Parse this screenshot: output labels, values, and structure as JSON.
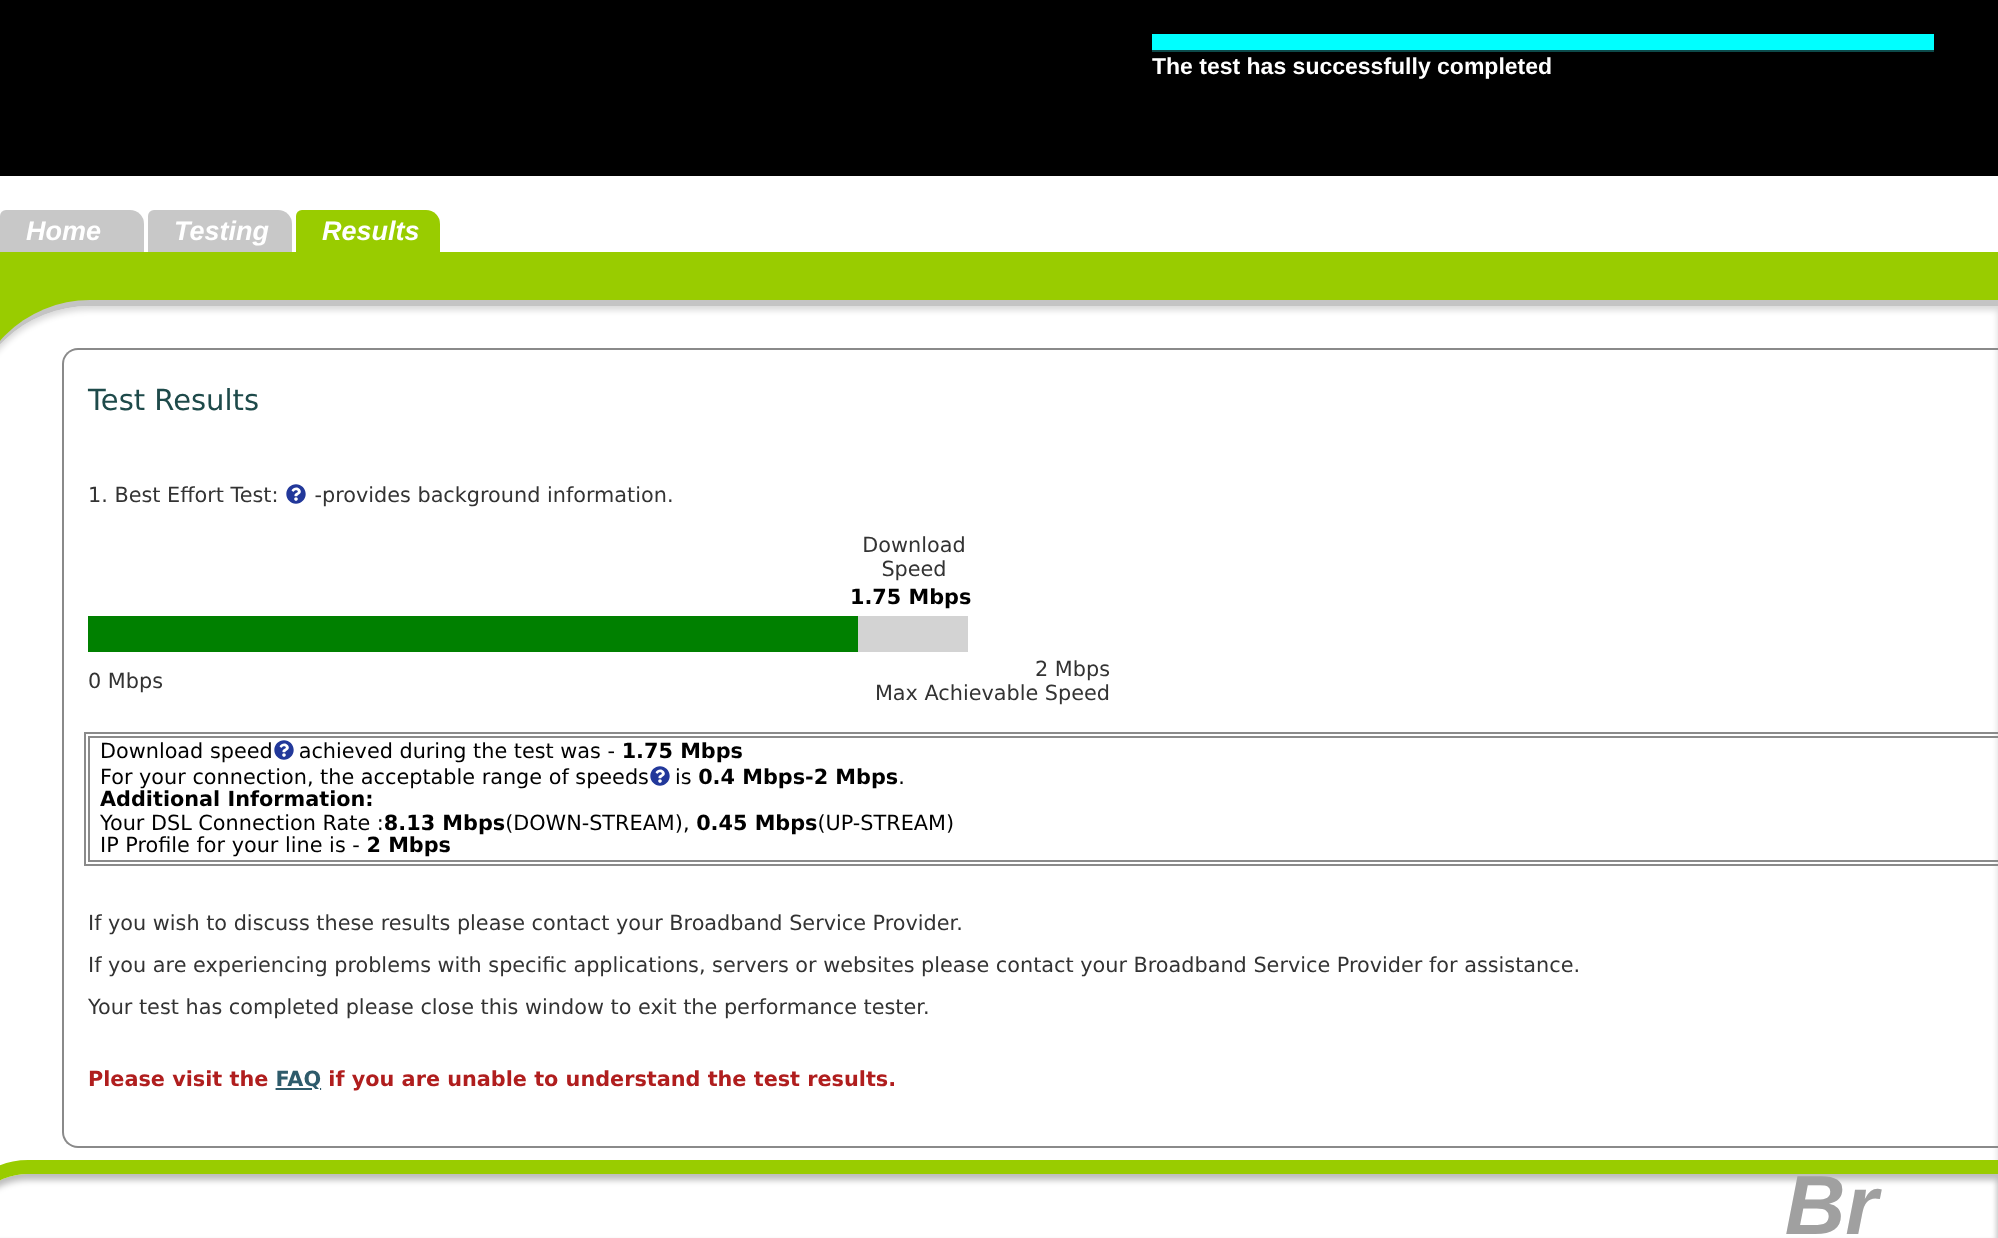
{
  "header": {
    "progress": {
      "level": 1
    },
    "status": "The test has successfully completed"
  },
  "tabs": [
    {
      "label": "Home",
      "selected": false
    },
    {
      "label": "Testing",
      "selected": false
    },
    {
      "label": "Results",
      "selected": true
    }
  ],
  "results": {
    "title": "Test Results",
    "test_heading": {
      "parts": [
        "1. Best Effort Test:",
        "-provides background information."
      ]
    },
    "speed_meter": {
      "label": "Download Speed",
      "reading": "1.75 Mbps",
      "level": 0.875,
      "min_label": "0 Mbps",
      "max_label": "2 Mbps",
      "max_caption": "Max Achievable Speed"
    },
    "info_box": {
      "lines": [
        {
          "kind": "text",
          "parts": [
            "Download speed",
            "achieved during the test was - **1.75 Mbps**"
          ]
        },
        {
          "kind": "text",
          "parts": [
            "For your connection, the acceptable range of speeds",
            "is **0.4 Mbps-2 Mbps**."
          ]
        },
        {
          "kind": "heading",
          "parts": [
            "Additional Information:"
          ]
        },
        {
          "kind": "text",
          "parts": [
            "Your DSL Connection Rate :**8.13 Mbps**(DOWN-STREAM), **0.45 Mbps**(UP-STREAM)"
          ]
        },
        {
          "kind": "text",
          "parts": [
            "IP Profile for your line is - **2 Mbps**"
          ]
        }
      ]
    },
    "paragraphs": [
      "If you wish to discuss these results please contact your Broadband Service Provider.",
      "If you are experiencing problems with specific applications, servers or websites please contact your Broadband Service Provider for assistance.",
      "Your test has completed please close this window to exit the performance tester."
    ],
    "notice": {
      "before": "Please visit the ",
      "link": "FAQ",
      "after": " if you are unable to understand the test results."
    }
  },
  "footer": {
    "logo_text": "Br"
  }
}
